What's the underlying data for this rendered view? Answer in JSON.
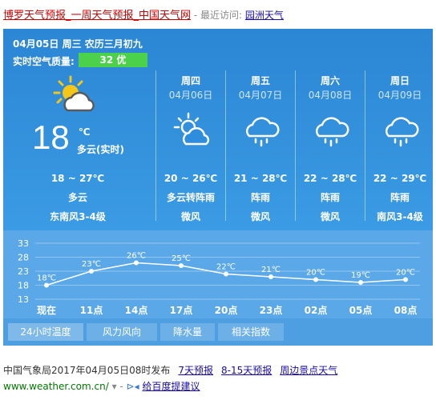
{
  "header": {
    "title_city": "博罗天气预报",
    "title_sep1": "_",
    "title_week": "一周天气预报",
    "title_sep2": "_",
    "title_site": "中国天气网",
    "recent_label": " - 最近访问: ",
    "recent_city": "园洲天气"
  },
  "today": {
    "date_line": "04月05日 周三 农历三月初九",
    "aqi_label": "实时空气质量:",
    "aqi_value": "32 优",
    "aqi_color": "#4cd24a",
    "temp": "18",
    "unit": "℃",
    "desc": "多云(实时)",
    "range": "18 ~ 27℃",
    "weather": "多云",
    "wind": "东南风3-4级",
    "icon": "sun-cloud-icon"
  },
  "forecast": [
    {
      "day": "周四",
      "date": "04月06日",
      "range": "20 ~ 26℃",
      "weather": "多云转阵雨",
      "wind": "微风",
      "icon": "sun-cloud-icon"
    },
    {
      "day": "周五",
      "date": "04月07日",
      "range": "21 ~ 28℃",
      "weather": "阵雨",
      "wind": "微风",
      "icon": "rain-cloud-icon"
    },
    {
      "day": "周六",
      "date": "04月08日",
      "range": "22 ~ 28℃",
      "weather": "阵雨",
      "wind": "微风",
      "icon": "rain-cloud-icon"
    },
    {
      "day": "周日",
      "date": "04月09日",
      "range": "22 ~ 29℃",
      "weather": "阵雨",
      "wind": "南风3-4级",
      "icon": "rain-cloud-icon"
    }
  ],
  "chart_data": {
    "type": "line",
    "categories": [
      "现在",
      "11点",
      "14点",
      "17点",
      "20点",
      "23点",
      "02点",
      "05点",
      "08点"
    ],
    "values": [
      18,
      23,
      26,
      25,
      22,
      21,
      20,
      19,
      20
    ],
    "value_labels": [
      "18℃",
      "23℃",
      "26℃",
      "25℃",
      "22℃",
      "21℃",
      "20℃",
      "19℃",
      "20℃"
    ],
    "yticks": [
      33,
      28,
      23,
      18,
      13
    ],
    "ylim": [
      13,
      33
    ],
    "grid": true
  },
  "tabs": [
    "24小时温度",
    "风力风向",
    "降水量",
    "相关指数"
  ],
  "footer": {
    "publish": "中国气象局2017年04月05日08时发布",
    "link1": "7天预报",
    "link2": "8-15天预报",
    "link3": "周边景点天气",
    "url": "www.weather.com.cn/",
    "url_arrow": " ▾ - ",
    "feedback": "给百度提建议"
  }
}
